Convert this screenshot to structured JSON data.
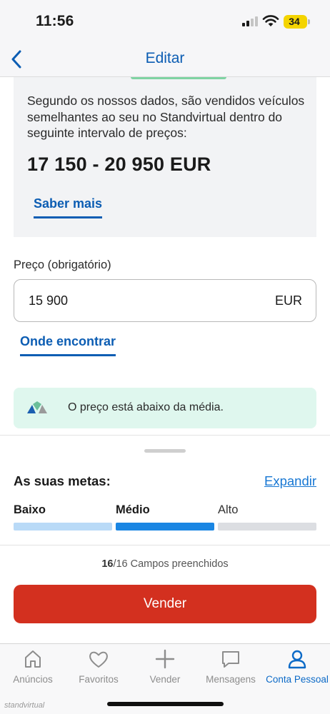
{
  "status_bar": {
    "time": "11:56",
    "battery": "34"
  },
  "header": {
    "title": "Editar"
  },
  "price_range": {
    "description": "Segundo os nossos dados, são vendidos veículos semelhantes ao seu no Standvirtual dentro do seguinte intervalo de preços:",
    "value": "17 150 - 20 950 EUR",
    "learn_more": "Saber mais"
  },
  "price": {
    "label": "Preço (obrigatório)",
    "value": "15 900",
    "unit": "EUR",
    "where_to_find": "Onde encontrar"
  },
  "indicator": {
    "text": "O preço está abaixo da média."
  },
  "goals": {
    "title": "As suas metas:",
    "expand": "Expandir",
    "levels": [
      {
        "label": "Baixo",
        "bold": true,
        "color": "#b9daf7"
      },
      {
        "label": "Médio",
        "bold": true,
        "color": "#1a86e3"
      },
      {
        "label": "Alto",
        "bold": false,
        "color": "#dcdee2"
      }
    ]
  },
  "fields": {
    "filled": "16",
    "total": "/16 Campos preenchidos"
  },
  "sell_button": "Vender",
  "tabs": [
    {
      "label": "Anúncios",
      "icon": "home-icon",
      "active": false
    },
    {
      "label": "Favoritos",
      "icon": "heart-icon",
      "active": false
    },
    {
      "label": "Vender",
      "icon": "plus-icon",
      "active": false
    },
    {
      "label": "Mensagens",
      "icon": "chat-bubble-icon",
      "active": false
    },
    {
      "label": "Conta Pessoal",
      "icon": "user-icon",
      "active": true
    }
  ],
  "watermark": "standvirtual",
  "colors": {
    "accent_blue": "#0c5db3",
    "sell_red": "#d3301f",
    "indicator_green": "#dff7ee"
  }
}
